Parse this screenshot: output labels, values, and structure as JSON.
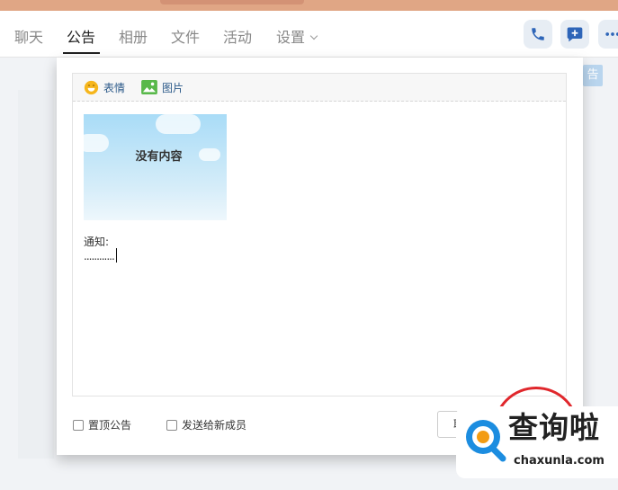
{
  "tabs": [
    {
      "label": "聊天"
    },
    {
      "label": "公告"
    },
    {
      "label": "相册"
    },
    {
      "label": "文件"
    },
    {
      "label": "活动"
    },
    {
      "label": "设置"
    }
  ],
  "background": {
    "badge": "告"
  },
  "editor": {
    "emoji_label": "表情",
    "image_label": "图片",
    "image_placeholder": "没有内容",
    "note_label": "通知:",
    "note_text": "............"
  },
  "footer": {
    "pin_label": "置顶公告",
    "send_new_label": "发送给新成员",
    "cancel_label": "取消"
  },
  "watermark": {
    "title": "查询啦",
    "url": "chaxunla.com"
  },
  "colors": {
    "accent": "#2d5b8a",
    "highlight": "#e0272c",
    "header": "#e0a685",
    "icon": "#2e65b8"
  }
}
